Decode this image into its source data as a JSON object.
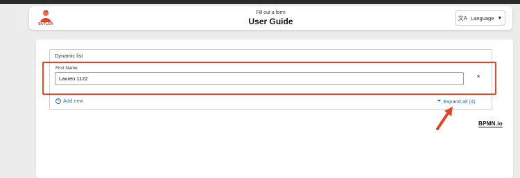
{
  "header": {
    "subtitle": "Fill out a form",
    "title": "User Guide",
    "logo_text": "BUTLER",
    "language_label": "Language",
    "language_icon": "translate-icon",
    "caret": "▼"
  },
  "form": {
    "dynamic_list_title": "Dynamic list",
    "first_name_label": "First Name",
    "first_name_value": "Lauren 1122",
    "remove_glyph": "×",
    "add_new_label": "Add new",
    "expand_all_label": "Expand all (4)"
  },
  "branding": {
    "bpmn_label": "BPMN.io"
  },
  "colors": {
    "accent": "#1f6fc5",
    "highlight": "#e2462a",
    "brand": "#d8452f"
  }
}
